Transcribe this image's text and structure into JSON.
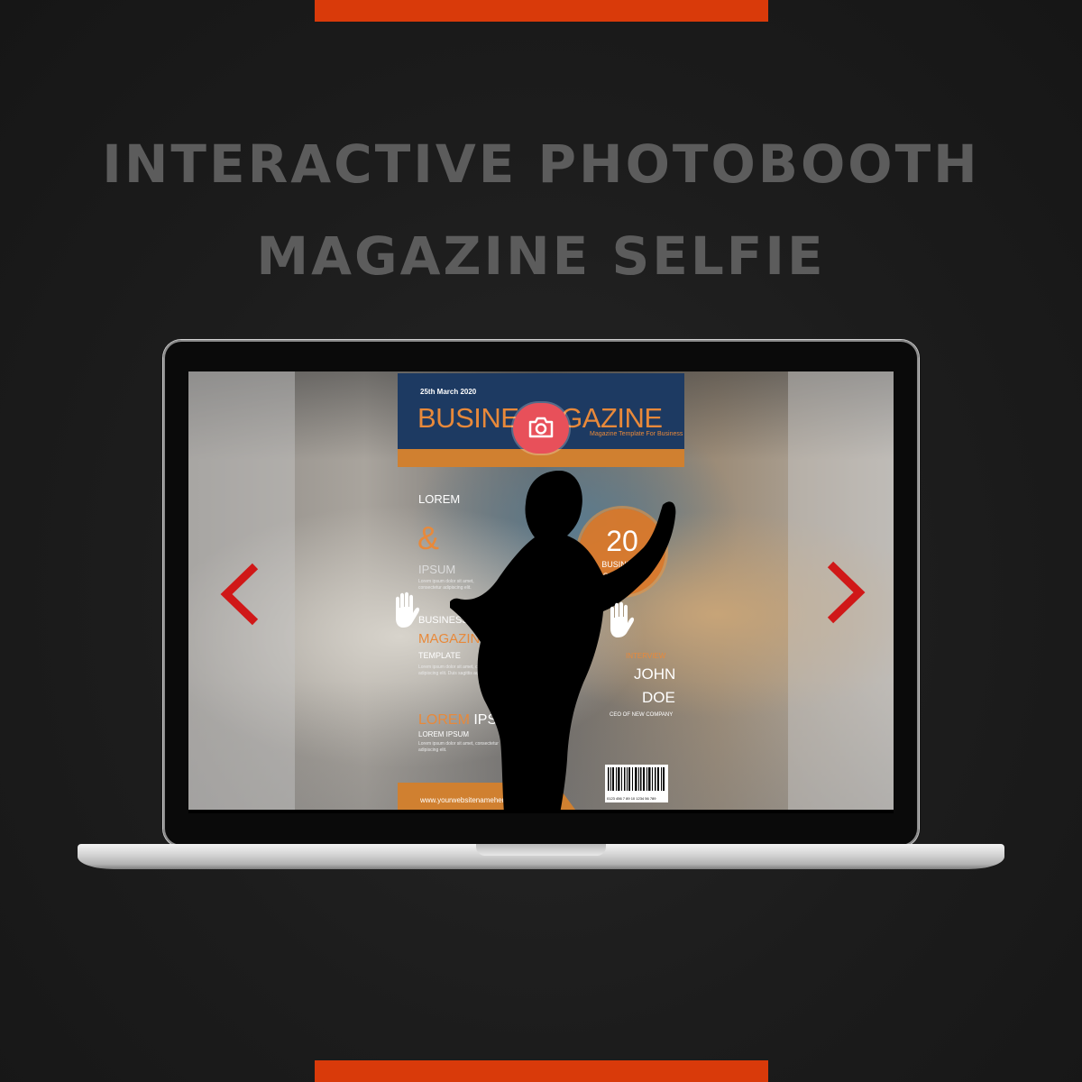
{
  "headline": {
    "line1": "INTERACTIVE PHOTOBOOTH",
    "line2": "MAGAZINE SELFIE"
  },
  "colors": {
    "accent": "#d93a0a",
    "magazine_navy": "#1d3a62",
    "magazine_orange": "#e8893a",
    "nav_arrow": "#d01818",
    "camera_button": "#e8505a"
  },
  "icons": {
    "prev": "chevron-left-icon",
    "next": "chevron-right-icon",
    "capture": "camera-icon",
    "gesture": "hand-icon"
  },
  "magazine": {
    "date": "25th March 2020",
    "title": "BUSINES  AGAZINE",
    "subtitle": "Magazine Template For Business",
    "lorem": "LOREM",
    "ampersand": "&",
    "ipsum": "IPSUM",
    "small_text_1": "Lorem ipsum dolor sit amet, consectetur adipiscing elit.",
    "business": "BUSINESS",
    "magazine": "MAGAZINE",
    "template": "TEMPLATE",
    "small_text_2": "Lorem ipsum dolor sit amet, consectetur adipiscing elit. Duis sagittis ac.",
    "lorem_ipsum_orange": "LOREM",
    "lorem_ipsum_white": " IPSUM",
    "lorem_ipsum_small": "LOREM IPSUM",
    "small_text_3": "Lorem ipsum dolor sit amet, consectetur adipiscing elit.",
    "badge_number": "20",
    "badge_line1": "BUSINESS",
    "badge_line2": "SECRETS",
    "interview_label": "INTERVIEW",
    "interview_first": "JOHN",
    "interview_last": "DOE",
    "interview_role": "CEO OF NEW COMPANY",
    "barcode_digits": "0123 456 7 89 10 1234 56 789",
    "footer_url": "www.yourwebsitenamehere.com"
  }
}
